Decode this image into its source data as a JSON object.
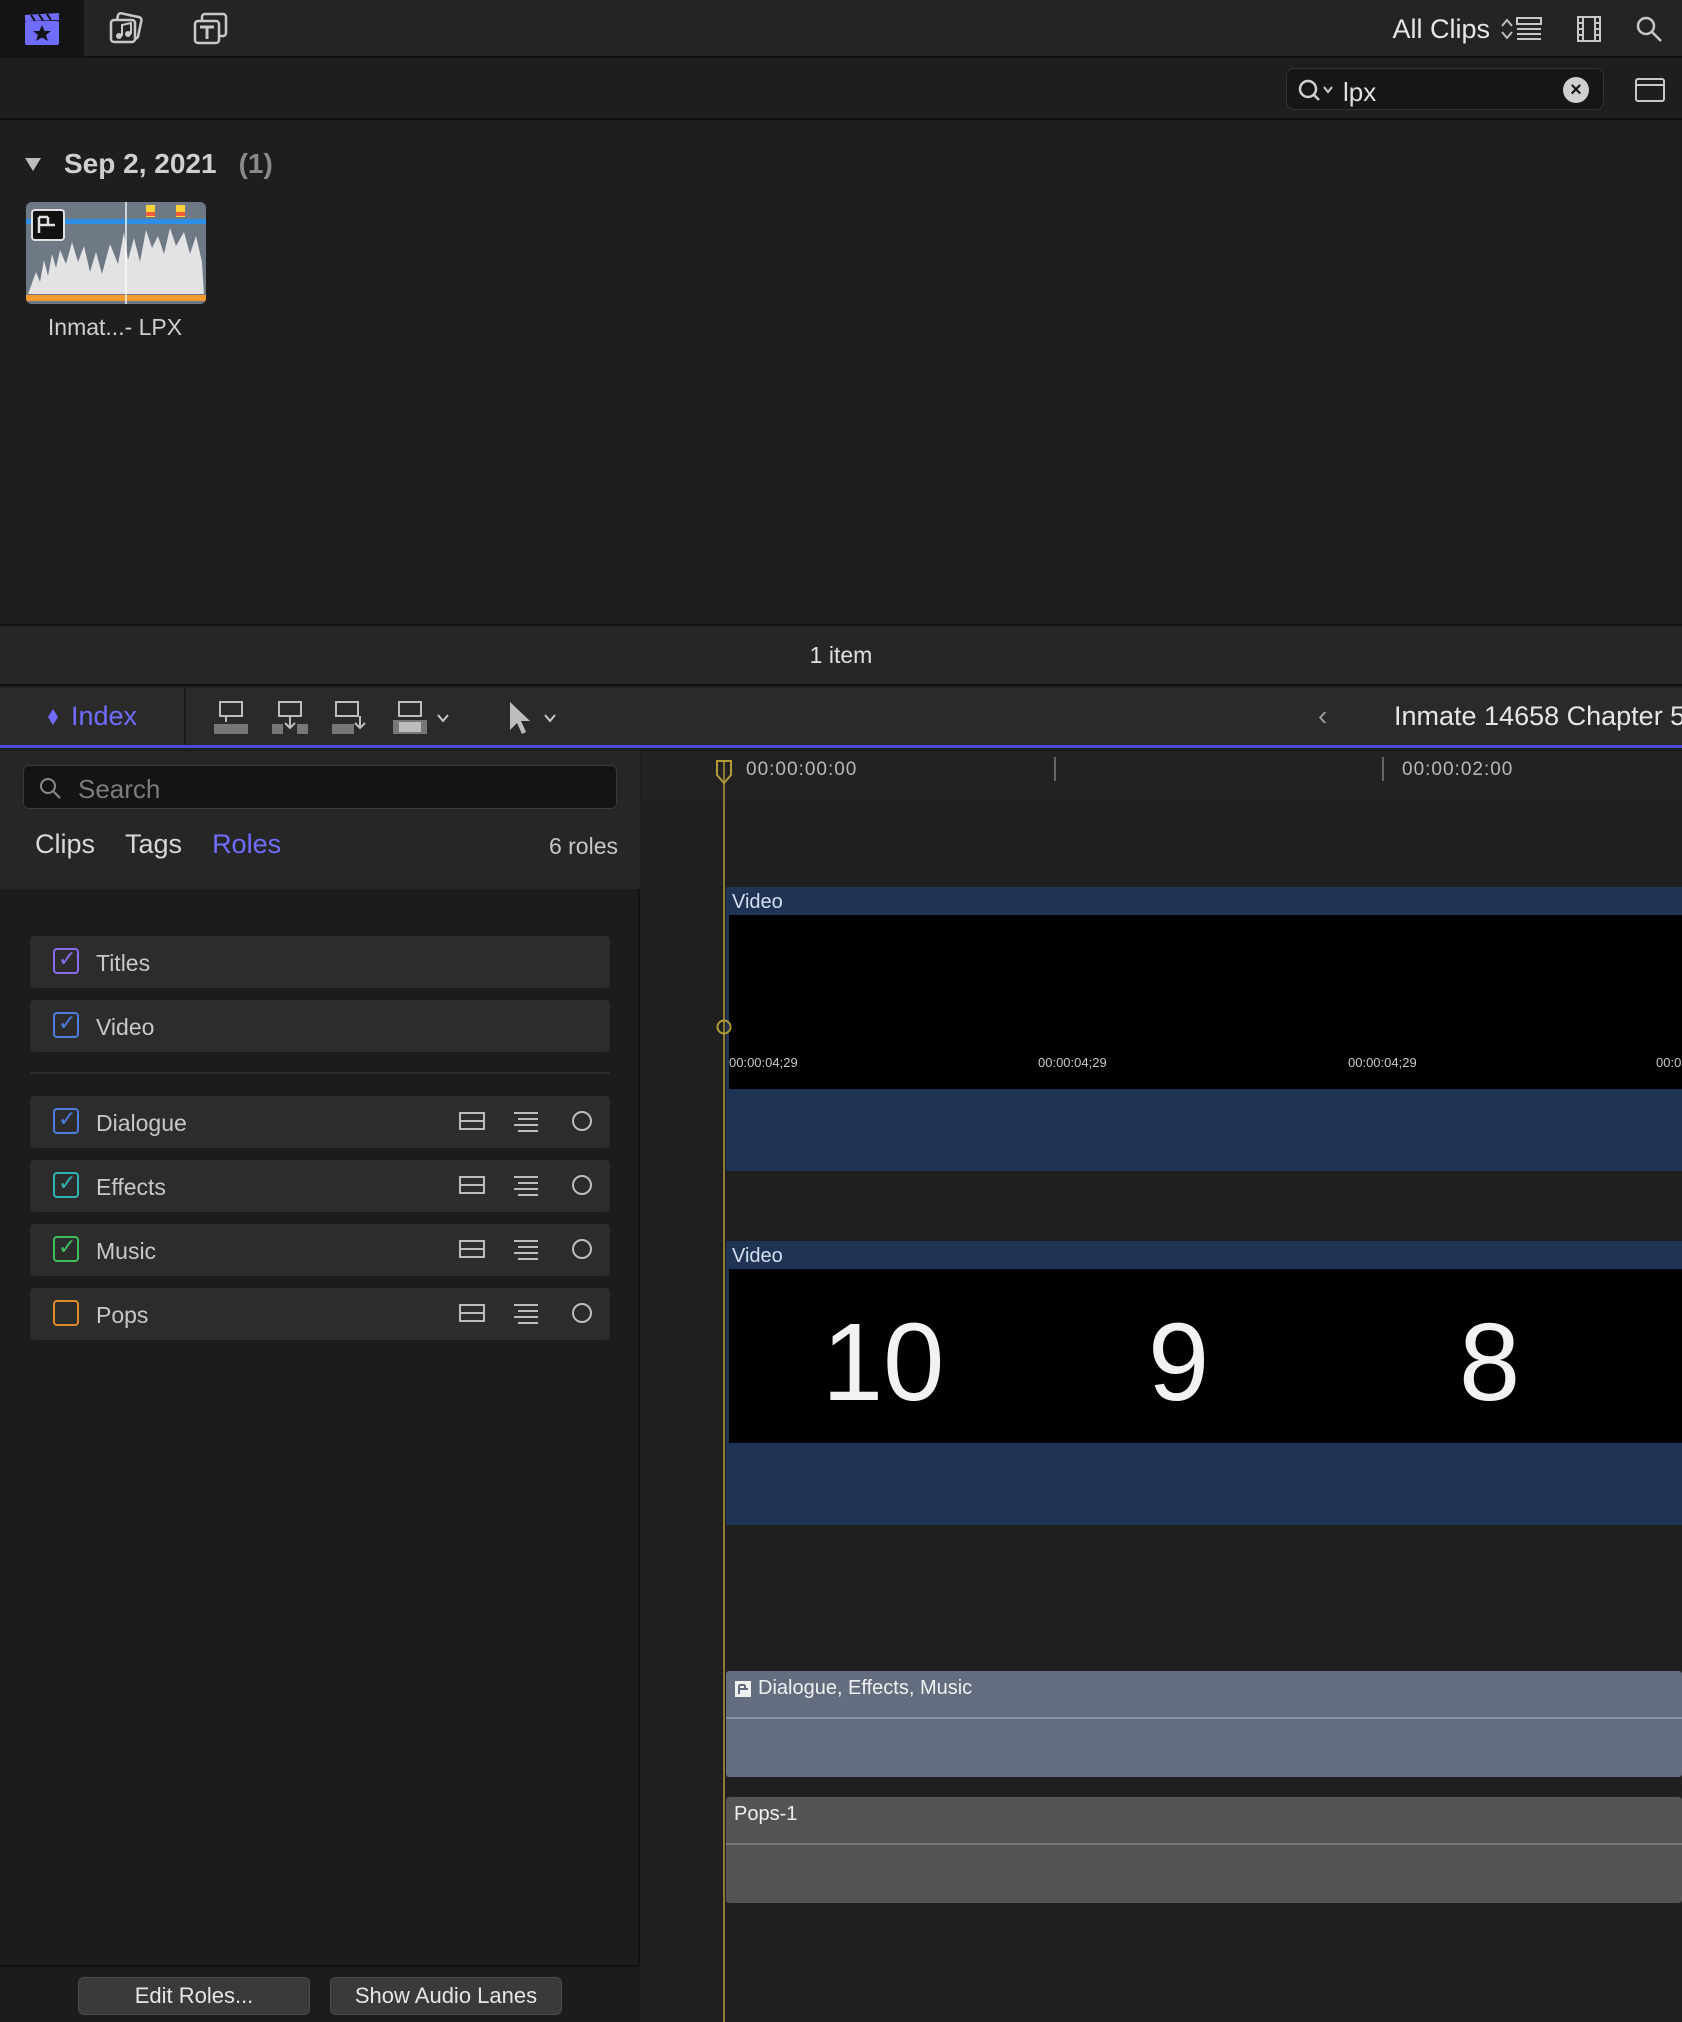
{
  "browser": {
    "filter": {
      "label": "All Clips"
    },
    "search": {
      "value": "lpx",
      "clear_symbol": "×"
    },
    "events": [
      {
        "date": "Sep 2, 2021",
        "count": "(1)"
      }
    ],
    "clips": [
      {
        "label": "Inmat...- LPX"
      }
    ],
    "status": "1 item"
  },
  "timeline_toolbar": {
    "index_label": "Index",
    "project_name": "Inmate 14658 Chapter 5"
  },
  "index": {
    "search_placeholder": "Search",
    "tabs": [
      "Clips",
      "Tags",
      "Roles"
    ],
    "active_tab": "Roles",
    "roles_count": "6 roles",
    "roles": [
      {
        "name": "Titles",
        "checked": true,
        "color": "#8b6cf0"
      },
      {
        "name": "Video",
        "checked": true,
        "color": "#4a7fe0"
      },
      {
        "name": "Dialogue",
        "checked": true,
        "color": "#4a7fe0"
      },
      {
        "name": "Effects",
        "checked": true,
        "color": "#2fb3b3"
      },
      {
        "name": "Music",
        "checked": true,
        "color": "#3fbf5a"
      },
      {
        "name": "Pops",
        "checked": false,
        "color": "#e08a2a"
      }
    ],
    "buttons": {
      "edit_roles": "Edit Roles...",
      "show_audio_lanes": "Show Audio Lanes"
    }
  },
  "timeline": {
    "ruler": [
      "00:00:00:00",
      "00:00:02:00"
    ],
    "video_clips": [
      {
        "label": "Video",
        "frame_timecodes": [
          "00:00:04;29",
          "00:00:04;29",
          "00:00:04;29",
          "00:0"
        ]
      },
      {
        "label": "Video",
        "countdown": [
          "10",
          "9",
          "8"
        ]
      }
    ],
    "audio_clips": [
      {
        "label": "Dialogue, Effects, Music",
        "color": "#646d7f"
      },
      {
        "label": "Pops-1",
        "color": "#545454"
      }
    ]
  },
  "colors": {
    "accent": "#6f6cff",
    "playhead": "#8a7a33",
    "video_clip": "#1f3354"
  }
}
